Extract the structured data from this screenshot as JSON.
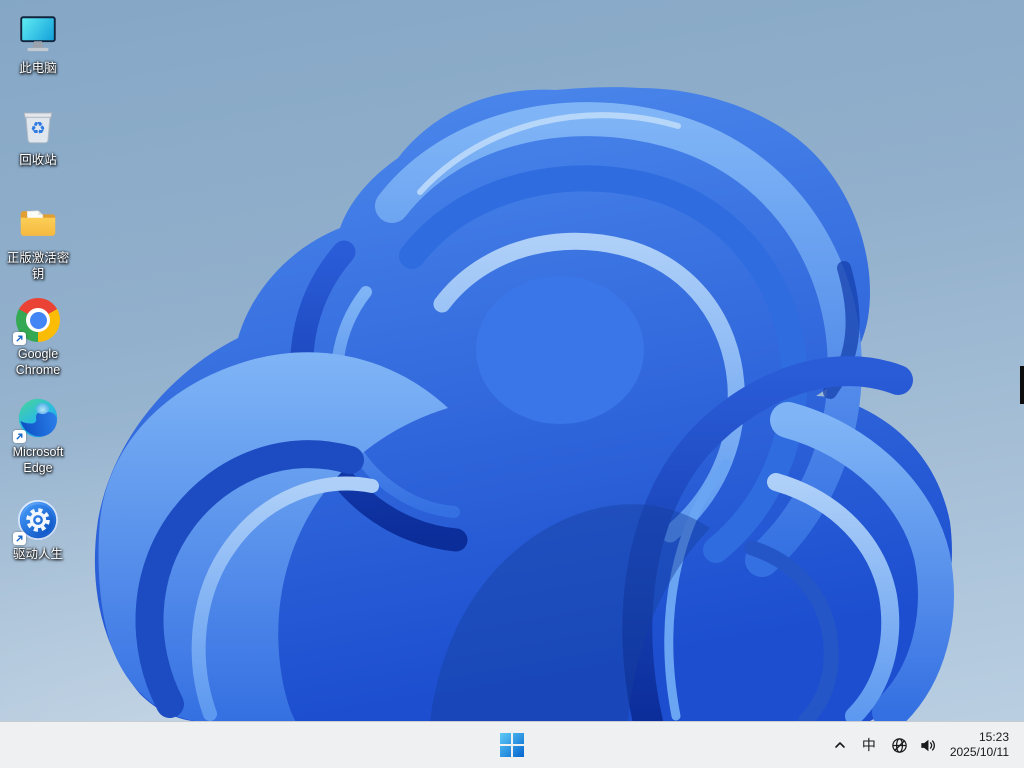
{
  "desktop": {
    "icons": [
      {
        "name": "this-pc",
        "label": "此电脑"
      },
      {
        "name": "recycle-bin",
        "label": "回收站"
      },
      {
        "name": "activation-key-folder",
        "label": "正版激活密钥"
      },
      {
        "name": "google-chrome",
        "label": "Google Chrome"
      },
      {
        "name": "microsoft-edge",
        "label": "Microsoft Edge"
      },
      {
        "name": "driver-life",
        "label": "驱动人生"
      }
    ]
  },
  "taskbar": {
    "start_icon": "windows-11-logo",
    "tray": {
      "chevron_icon": "chevron-up",
      "ime": "中",
      "network_icon": "globe-no-internet",
      "volume_icon": "speaker",
      "clock": {
        "time": "15:23",
        "date": "2025/10/11"
      }
    }
  },
  "colors": {
    "taskbar_bg": "#eff0f1",
    "taskbar_border": "#c9ccd1",
    "taskbar_text": "#1b1b1b",
    "wallpaper_sky_top": "#85a7c6",
    "wallpaper_sky_bottom": "#bdd1e3",
    "bloom_blue": "#2a5fd6"
  }
}
